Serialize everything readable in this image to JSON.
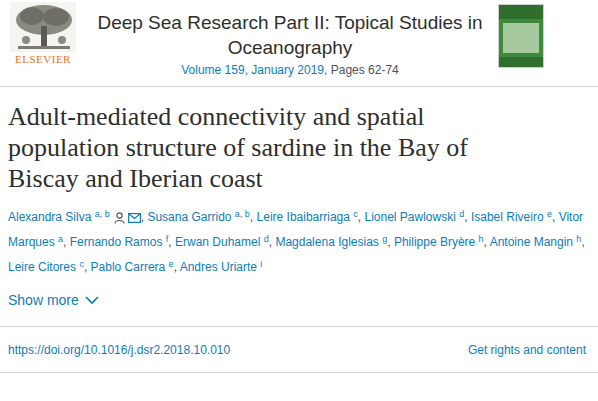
{
  "header": {
    "publisher": "ELSEVIER",
    "journal": "Deep Sea Research Part II: Topical Studies in Oceanography",
    "issue": "Volume 159, January 2019",
    "pages": ", Pages 62-74"
  },
  "article": {
    "title": "Adult-mediated connectivity and spatial population structure of sardine in the Bay of Biscay and Iberian coast"
  },
  "authors": {
    "separator": ",",
    "items": [
      {
        "name": "Alexandra Silva",
        "affiliations": "a, b",
        "corresponding": true
      },
      {
        "name": "Susana Garrido",
        "affiliations": "a, b",
        "corresponding": false
      },
      {
        "name": "Leire Ibaibarriaga",
        "affiliations": "c",
        "corresponding": false
      },
      {
        "name": "Lionel Pawlowski",
        "affiliations": "d",
        "corresponding": false
      },
      {
        "name": "Isabel Riveiro",
        "affiliations": "e",
        "corresponding": false
      },
      {
        "name": "Vitor Marques",
        "affiliations": "a",
        "corresponding": false
      },
      {
        "name": "Fernando Ramos",
        "affiliations": "f",
        "corresponding": false
      },
      {
        "name": "Erwan Duhamel",
        "affiliations": "d",
        "corresponding": false
      },
      {
        "name": "Magdalena Iglesias",
        "affiliations": "g",
        "corresponding": false
      },
      {
        "name": "Philippe Bryère",
        "affiliations": "h",
        "corresponding": false
      },
      {
        "name": "Antoine Mangin",
        "affiliations": "h",
        "corresponding": false
      },
      {
        "name": "Leire Citores",
        "affiliations": "c",
        "corresponding": false
      },
      {
        "name": "Pablo Carrera",
        "affiliations": "e",
        "corresponding": false
      },
      {
        "name": "Andres Uriarte",
        "affiliations": "i",
        "corresponding": false
      }
    ]
  },
  "show_more": "Show more",
  "doi": "https://doi.org/10.1016/j.dsr2.2018.10.010",
  "rights": "Get rights and content"
}
